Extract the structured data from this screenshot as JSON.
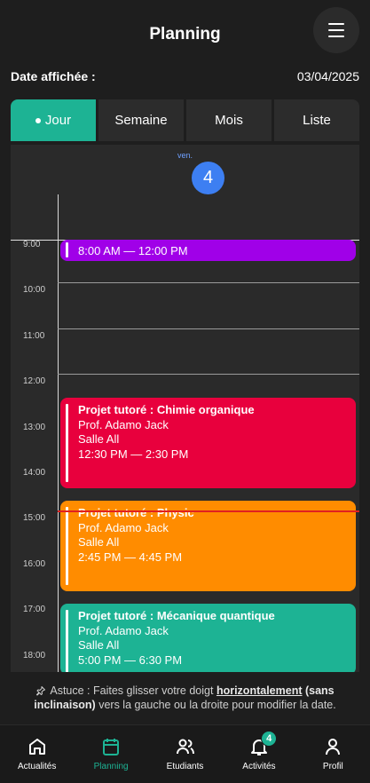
{
  "header": {
    "title": "Planning",
    "menu_icon": "hamburger-menu-icon"
  },
  "date_row": {
    "label": "Date affichée :",
    "value": "03/04/2025"
  },
  "tabs": [
    {
      "label": "Jour",
      "active": true
    },
    {
      "label": "Semaine",
      "active": false
    },
    {
      "label": "Mois",
      "active": false
    },
    {
      "label": "Liste",
      "active": false
    }
  ],
  "day": {
    "name": "ven.",
    "number": "4"
  },
  "hours": [
    "9:00",
    "10:00",
    "11:00",
    "12:00",
    "13:00",
    "14:00",
    "15:00",
    "16:00",
    "17:00",
    "18:00"
  ],
  "events": [
    {
      "title": "",
      "teacher": "",
      "room": "",
      "time": "8:00 AM — 12:00 PM",
      "color": "#a000e8"
    },
    {
      "title": "Projet tutoré : Chimie organique",
      "teacher": "Prof. Adamo Jack",
      "room": "Salle All",
      "time": "12:30 PM — 2:30 PM",
      "color": "#e8003d"
    },
    {
      "title": "Projet tutoré : Physic",
      "teacher": "Prof. Adamo Jack",
      "room": "Salle All",
      "time": "2:45 PM — 4:45 PM",
      "color": "#ff8c00"
    },
    {
      "title": "Projet tutoré : Mécanique quantique",
      "teacher": "Prof. Adamo Jack",
      "room": "Salle All",
      "time": "5:00 PM — 6:30 PM",
      "color": "#1db394"
    }
  ],
  "tip": {
    "prefix": "Astuce : Faites glisser votre doigt",
    "emphasis": "horizontalement",
    "bold_part": "(sans inclinaison)",
    "suffix": "vers la gauche ou la droite pour modifier la date."
  },
  "nav": [
    {
      "label": "Actualités",
      "icon": "home-icon",
      "active": false
    },
    {
      "label": "Planning",
      "icon": "calendar-icon",
      "active": true
    },
    {
      "label": "Etudiants",
      "icon": "users-icon",
      "active": false
    },
    {
      "label": "Activités",
      "icon": "bell-icon",
      "active": false,
      "badge": "4"
    },
    {
      "label": "Profil",
      "icon": "user-icon",
      "active": false
    }
  ],
  "colors": {
    "accent": "#1db394",
    "today": "#3d7ff2",
    "now_line": "#e02020"
  }
}
